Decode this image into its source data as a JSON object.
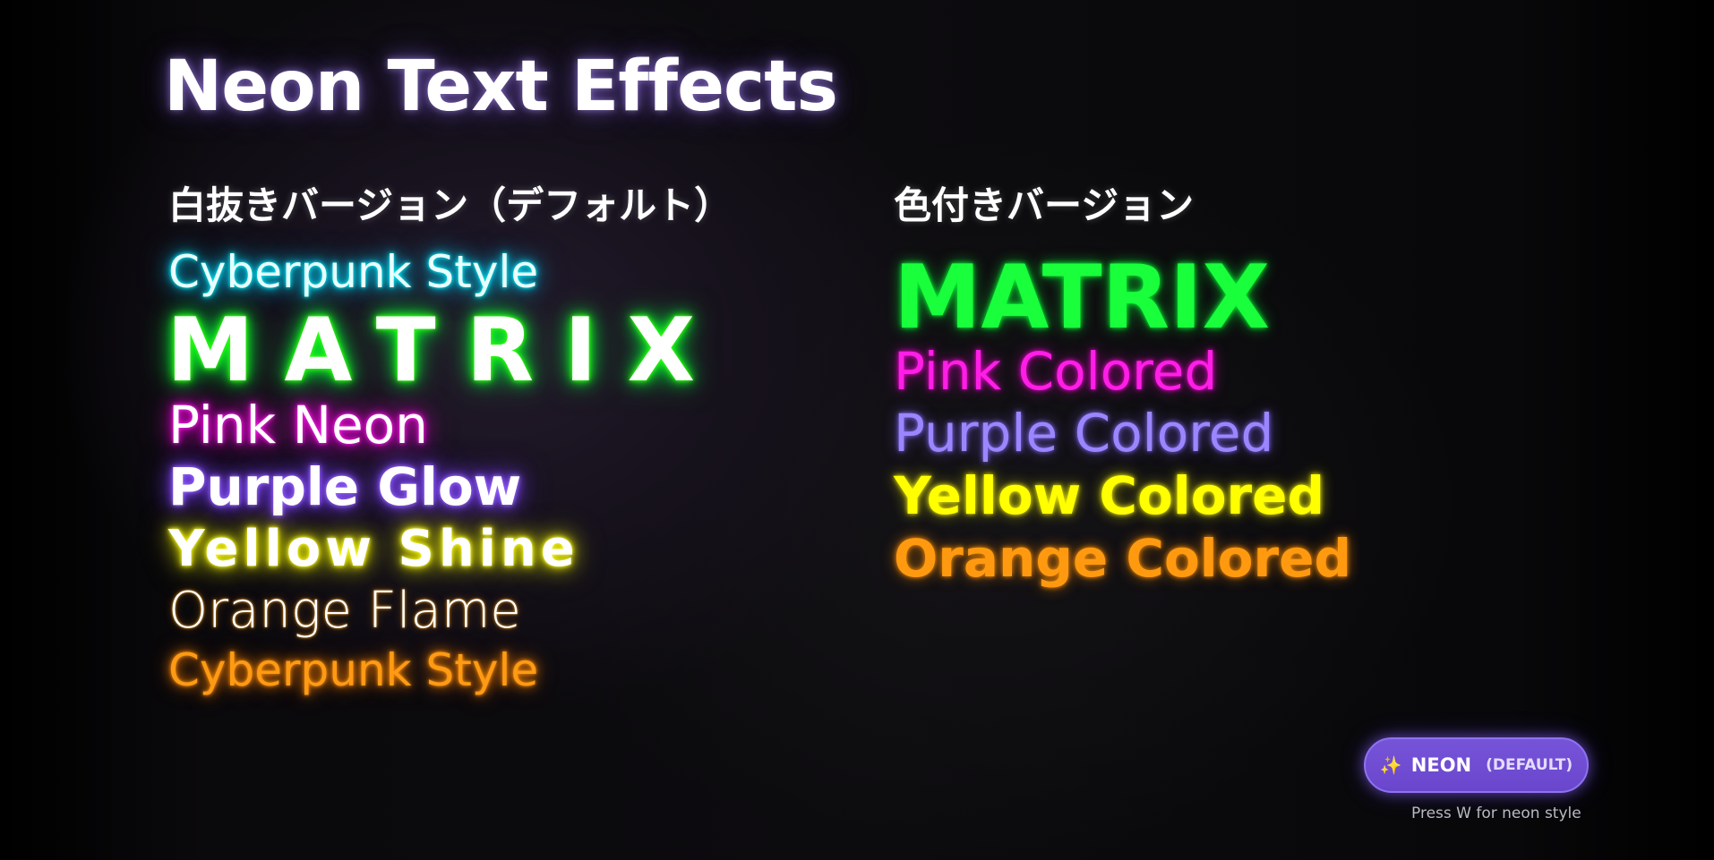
{
  "title": "Neon Text Effects",
  "sections": {
    "left_heading": "白抜きバージョン（デフォルト）",
    "right_heading": "色付きバージョン"
  },
  "white_lines": [
    "Cyberpunk Style",
    "MATRIX",
    "Pink Neon",
    "Purple Glow",
    "Yellow Shine",
    "Orange Flame",
    "Cyberpunk Style"
  ],
  "colored_lines": [
    "MATRIX",
    "Pink Colored",
    "Purple Colored",
    "Yellow Colored",
    "Orange Colored"
  ],
  "mode_button": {
    "icon": "sparkles-icon",
    "icon_glyph": "✨",
    "label": "NEON",
    "sub": "(DEFAULT)"
  },
  "hint": "Press W for neon style",
  "colors": {
    "cyan": "#00e5ff",
    "green": "#19ff3c",
    "pink": "#ff1ee6",
    "purple": "#9b86ff",
    "yellow": "#ffff00",
    "orange": "#ff9a10",
    "button": "#6a46cc"
  }
}
